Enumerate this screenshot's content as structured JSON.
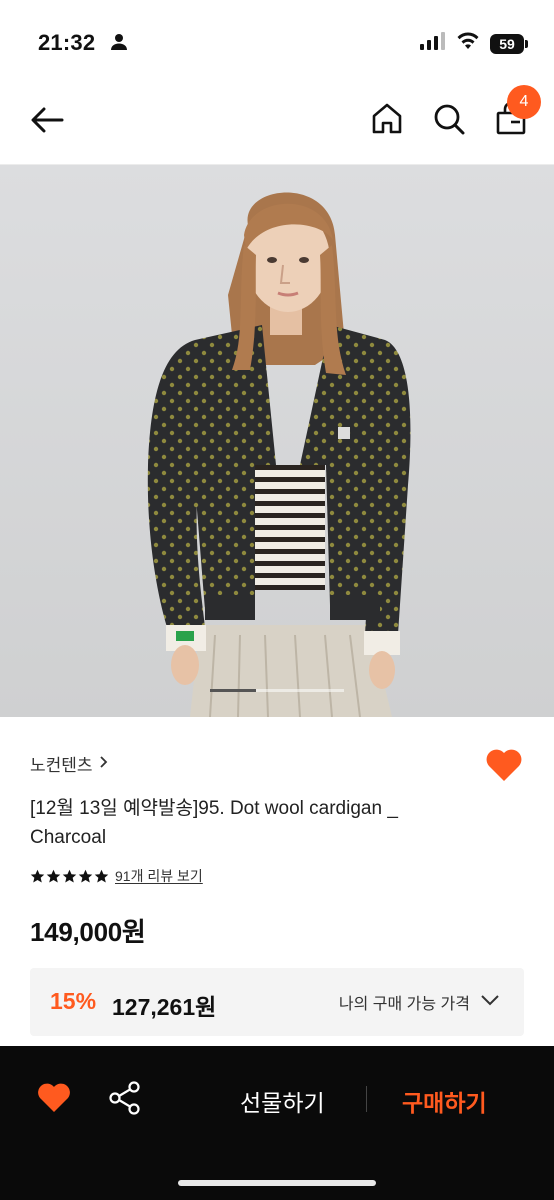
{
  "status_bar": {
    "time": "21:32",
    "battery": "59"
  },
  "nav": {
    "cart_count": "4"
  },
  "product": {
    "brand": "노컨텐츠",
    "title": "[12월 13일 예약발송]95. Dot wool cardigan _ Charcoal",
    "review_link": "91개 리뷰 보기",
    "rating_stars": 5,
    "price": "149,000원",
    "image_indicator": {
      "current": 1,
      "total": 3
    }
  },
  "discount": {
    "rate": "15%",
    "price": "127,261원",
    "cta": "나의 구매 가능 가격"
  },
  "bottom_bar": {
    "gift_label": "선물하기",
    "buy_label": "구매하기"
  },
  "colors": {
    "accent": "#ff5a1f",
    "bottom_bg": "#0a0a0a"
  },
  "icons": [
    "back-arrow-icon",
    "home-icon",
    "search-icon",
    "shopping-bag-icon",
    "heart-icon",
    "share-icon",
    "chevron-right-icon",
    "chevron-down-icon",
    "star-icon"
  ]
}
